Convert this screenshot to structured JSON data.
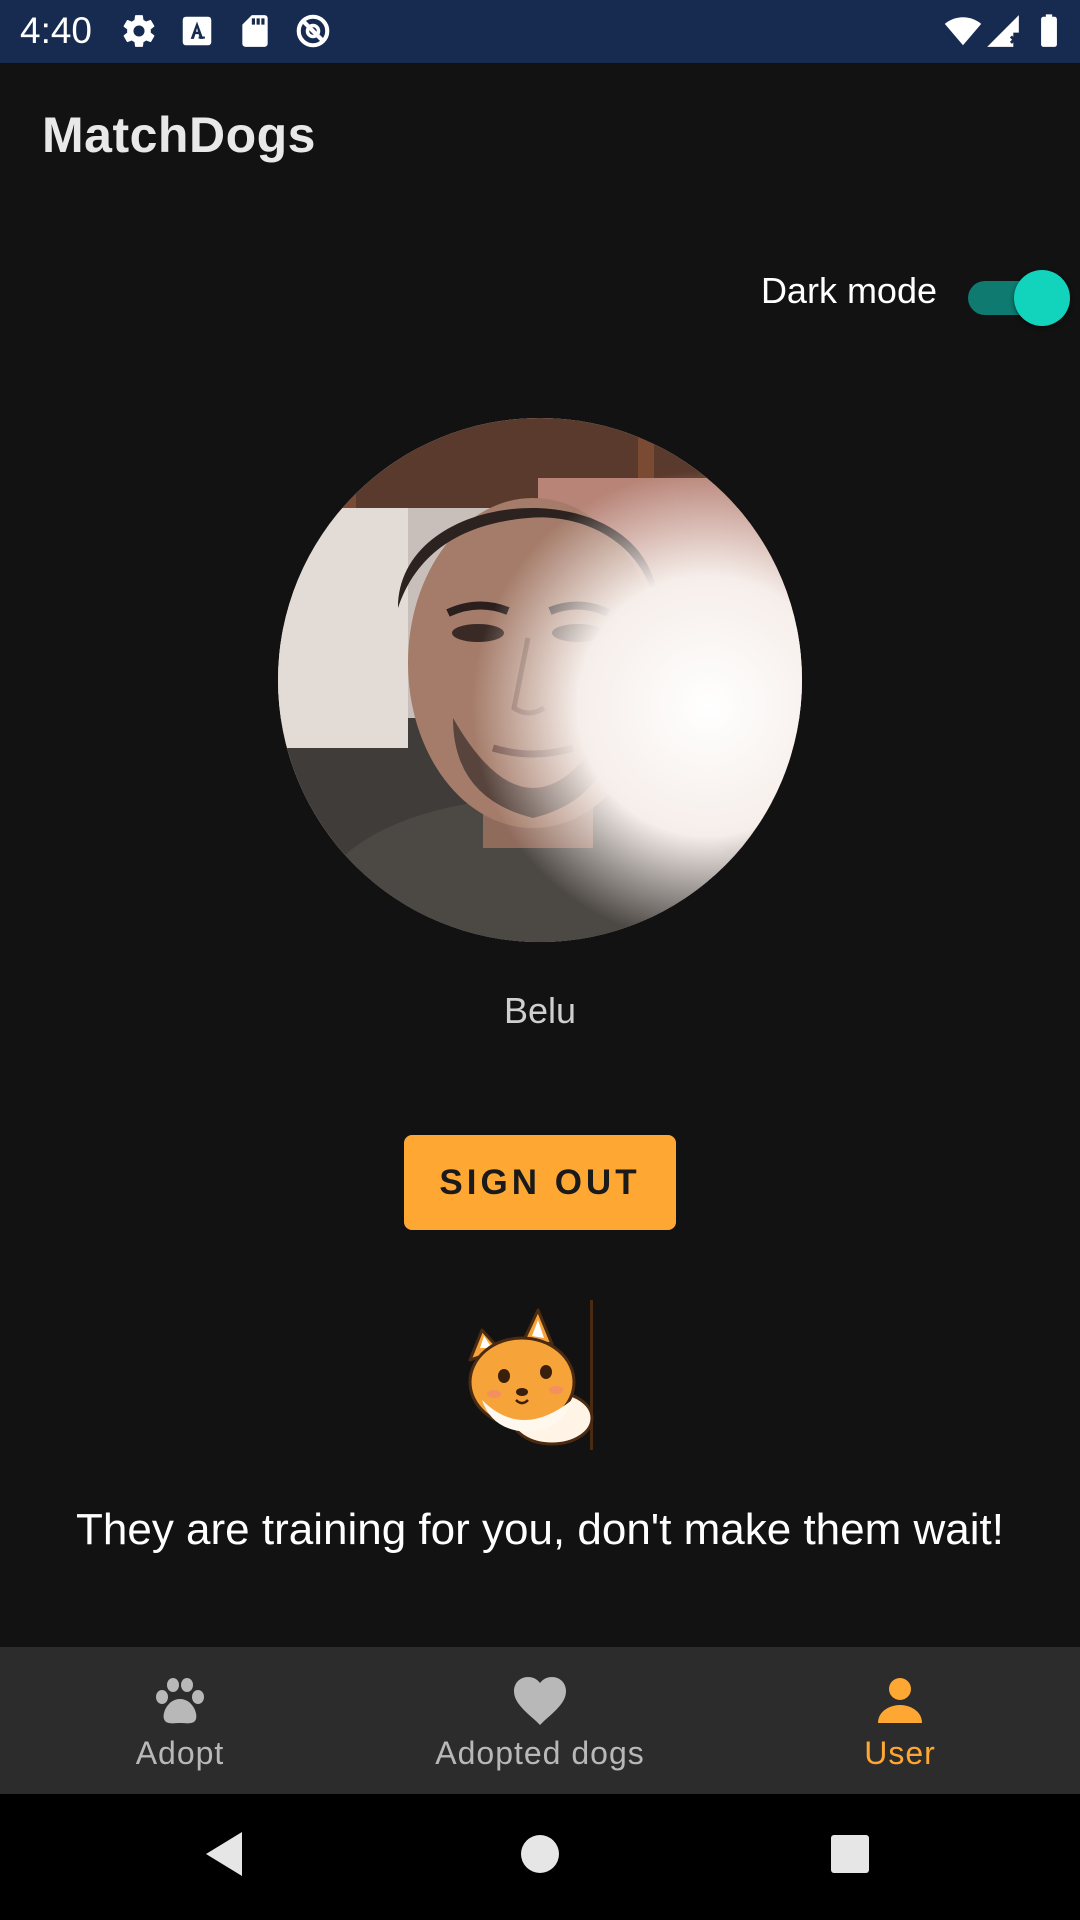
{
  "status_bar": {
    "time": "4:40",
    "icons_left": [
      "settings-icon",
      "text-a-icon",
      "sd-card-icon",
      "do-not-disturb-icon"
    ],
    "icons_right": [
      "wifi-icon",
      "signal-icon",
      "battery-icon"
    ]
  },
  "app": {
    "title": "MatchDogs"
  },
  "settings": {
    "dark_mode_label": "Dark mode",
    "dark_mode_on": true
  },
  "profile": {
    "name": "Belu",
    "sign_out_label": "SIGN OUT"
  },
  "tagline": "They are training for you, don't make them wait!",
  "bottom_nav": {
    "items": [
      {
        "label": "Adopt",
        "icon": "paw-icon",
        "active": false
      },
      {
        "label": "Adopted dogs",
        "icon": "heart-icon",
        "active": false
      },
      {
        "label": "User",
        "icon": "person-icon",
        "active": true
      }
    ]
  },
  "system_nav": {
    "buttons": [
      "back-icon",
      "home-icon",
      "recents-icon"
    ]
  },
  "colors": {
    "background": "#121212",
    "status_bar": "#172a4f",
    "accent": "#ffa733",
    "switch_thumb": "#12d3bc",
    "switch_track": "#0e7a70",
    "nav_background": "#2c2c2c"
  }
}
